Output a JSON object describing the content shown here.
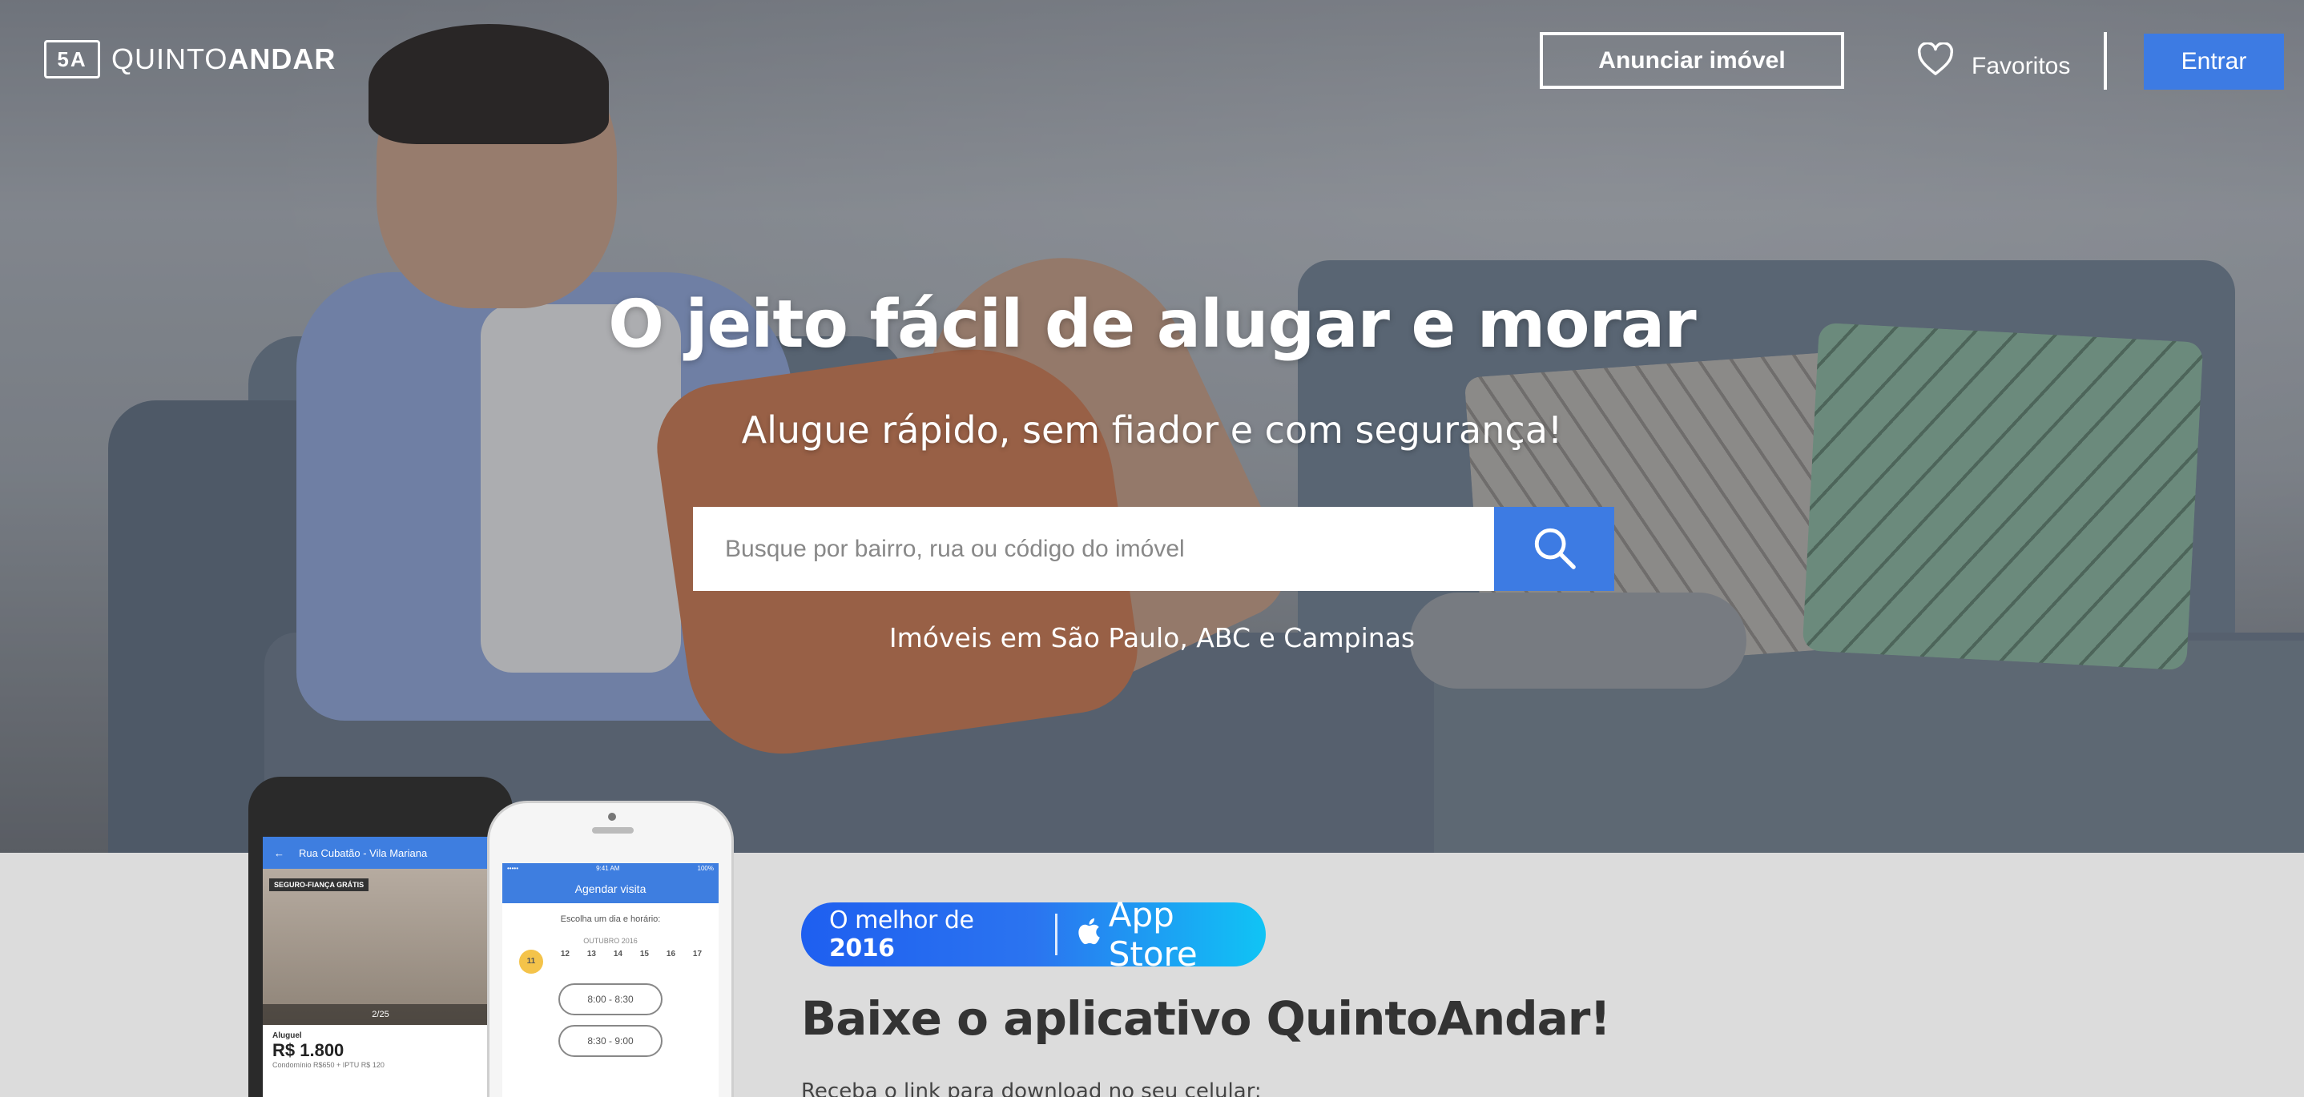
{
  "brand": {
    "logo_mark": "5A",
    "name_light": "QUINTO",
    "name_bold": "ANDAR"
  },
  "header": {
    "anunciar_label": "Anunciar imóvel",
    "favoritos_label": "Favoritos",
    "entrar_label": "Entrar",
    "accent_color": "#3d7be3"
  },
  "hero": {
    "title": "O jeito fácil de alugar e morar",
    "subtitle": "Alugue rápido, sem fiador e com segurança!",
    "search": {
      "placeholder": "Busque por bairro, rua ou código do imóvel",
      "value": "",
      "icon": "search-icon"
    },
    "cities": "Imóveis em São Paulo, ABC e Campinas"
  },
  "app_promo": {
    "badge": {
      "prefix": "O melhor de ",
      "year": "2016",
      "store": "App Store",
      "icon": "apple-icon"
    },
    "title_light": "Baixe o ",
    "title_bold": "aplicativo QuintoAndar!",
    "subtitle": "Receba o link para download no seu celular:",
    "android_mockup": {
      "bar_title": "Rua Cubatão - Vila Mariana",
      "badge": "SEGURO-FIANÇA GRÁTIS",
      "pager": "2/25",
      "price_label": "Aluguel",
      "price": "R$ 1.800",
      "fees": "Condomínio R$650 + IPTU R$ 120"
    },
    "ios_mockup": {
      "status_left": "••••• ",
      "status_time": "9:41 AM",
      "status_right": "100%",
      "bar_title": "Agendar visita",
      "prompt": "Escolha um dia e horário:",
      "month": "OUTUBRO 2016",
      "days": [
        "11",
        "12",
        "13",
        "14",
        "15",
        "16",
        "17"
      ],
      "slots": [
        "8:00 - 8:30",
        "8:30 - 9:00"
      ]
    }
  }
}
